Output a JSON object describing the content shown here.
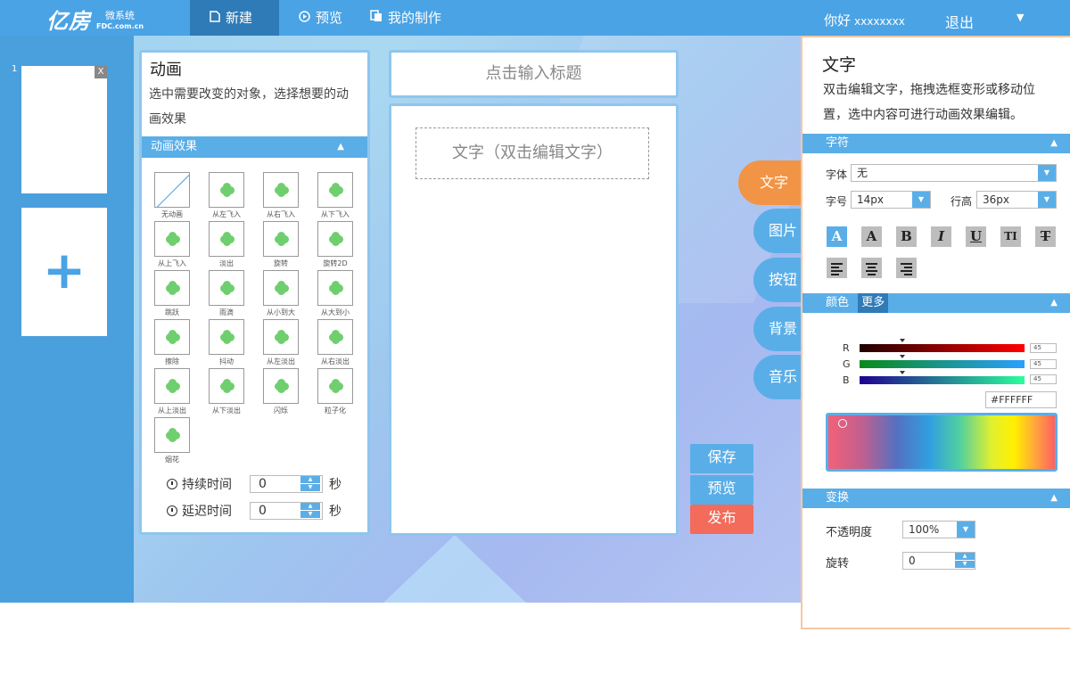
{
  "header": {
    "logo_text": "亿房",
    "logo_sub": "微系统",
    "logo_domain": "FDC.com.cn",
    "nav": [
      {
        "label": "新建",
        "icon": "document-icon"
      },
      {
        "label": "预览",
        "icon": "play-icon"
      },
      {
        "label": "我的制作",
        "icon": "copy-icon"
      }
    ],
    "greeting": "你好",
    "username": "xxxxxxxx",
    "logout": "退出"
  },
  "pages": {
    "page_number": "1",
    "close_label": "X",
    "add_label": "+"
  },
  "animation_panel": {
    "title": "动画",
    "description": "选中需要改变的对象，选择想要的动画效果",
    "section_label": "动画效果",
    "effects": [
      "无动画",
      "从左飞入",
      "从右飞入",
      "从下飞入",
      "从上飞入",
      "淡出",
      "旋转",
      "旋转2D",
      "跳跃",
      "雨滴",
      "从小到大",
      "从大到小",
      "擦除",
      "抖动",
      "从左淡出",
      "从右淡出",
      "从上淡出",
      "从下淡出",
      "闪烁",
      "粒子化",
      "烟花"
    ],
    "duration_label": "持续时间",
    "duration_value": "0",
    "delay_label": "延迟时间",
    "delay_value": "0",
    "unit": "秒"
  },
  "editor": {
    "title_placeholder": "点击输入标题",
    "text_placeholder": "文字（双击编辑文字）"
  },
  "side_tabs": [
    "文字",
    "图片",
    "按钮",
    "背景",
    "音乐"
  ],
  "actions": {
    "save": "保存",
    "preview": "预览",
    "publish": "发布"
  },
  "text_panel": {
    "title": "文字",
    "description": "双击编辑文字，拖拽选框变形或移动位置，选中内容可进行动画效果编辑。",
    "char_section": "字符",
    "font_label": "字体",
    "font_value": "无",
    "size_label": "字号",
    "size_value": "14px",
    "lineheight_label": "行高",
    "lineheight_value": "36px",
    "format_buttons": [
      "A",
      "A",
      "B",
      "I",
      "U",
      "TI",
      "T"
    ],
    "color_section": "颜色",
    "color_more": "更多",
    "r_label": "R",
    "g_label": "G",
    "b_label": "B",
    "r_value": "45",
    "g_value": "45",
    "b_value": "45",
    "hex_value": "#FFFFFF",
    "transform_section": "变换",
    "opacity_label": "不透明度",
    "opacity_value": "100%",
    "rotate_label": "旋转",
    "rotate_value": "0"
  },
  "colors": {
    "primary": "#4aa3e5",
    "nav_active": "#2f7bb8",
    "tab_active": "#f29445",
    "publish": "#f26b5b"
  }
}
